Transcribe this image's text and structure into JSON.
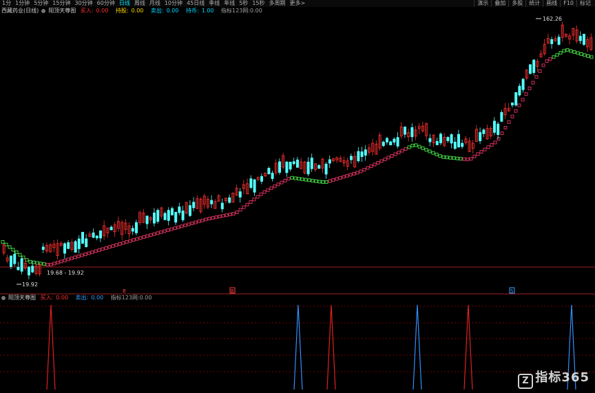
{
  "toolbar": {
    "items": [
      "1分",
      "1分钟",
      "5分钟",
      "15分钟",
      "30分钟",
      "60分钟",
      "日线",
      "周线",
      "月线",
      "10分钟",
      "45日线",
      "季线",
      "年线",
      "5秒",
      "15秒",
      "多周期",
      "更多>"
    ],
    "active_index": 6,
    "right_items": [
      "演示",
      "叠加",
      "多股",
      "统计",
      "画线",
      "F10",
      "标记"
    ]
  },
  "main_legend": {
    "stock": "西藏药业(日线)",
    "indicator": "阳顶天尊图",
    "buy_label": "买入:",
    "buy_value": "0.00",
    "hold_label": "持股:",
    "hold_value": "0.00",
    "sell_label": "卖出:",
    "sell_value": "0.00",
    "rise_label": "持币:",
    "rise_value": "1.00",
    "extra": "指标123网:0.00"
  },
  "sub_legend": {
    "indicator": "阳顶天尊图",
    "buy_label": "买入:",
    "buy_value": "0.00",
    "sell_label": "卖出:",
    "sell_value": "0.00",
    "extra": "指标123网:0.00"
  },
  "annotations": {
    "high": "162.26",
    "low": "19.92",
    "range": "19.68 - 19.92"
  },
  "markers": {
    "m1": "B",
    "m2": "B",
    "m3": "S"
  },
  "colors": {
    "up": "#ff3030",
    "down": "#54ffff",
    "line_red": "#d0305a",
    "line_green": "#40d040",
    "grid": "#7a0000",
    "sub_red": "#e02020",
    "sub_blue": "#3090ff"
  },
  "watermark": {
    "logo": "Z",
    "text": "指标365"
  }
}
